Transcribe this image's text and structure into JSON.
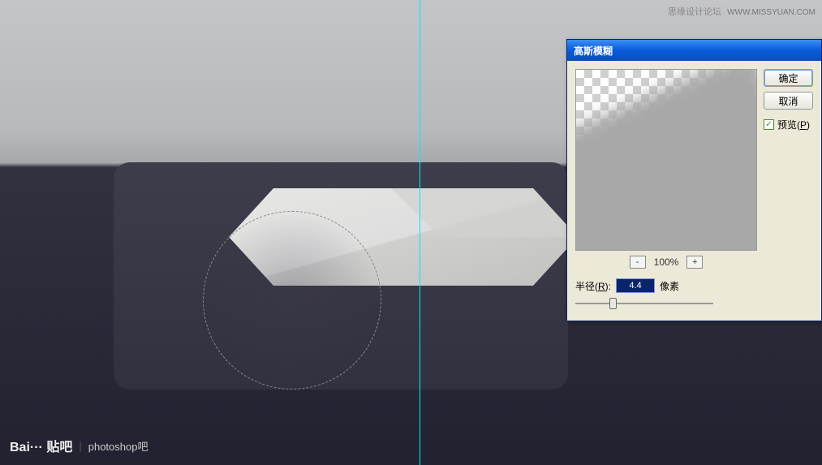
{
  "watermark": {
    "top_right_main": "思缘设计论坛",
    "top_right_sub": "WWW.MISSYUAN.COM",
    "bottom_left_brand": "Bai··· 贴吧",
    "bottom_left_sep": "|",
    "bottom_left_text": "photoshop吧"
  },
  "dialog": {
    "title": "高斯模糊",
    "ok_label": "确定",
    "cancel_label": "取消",
    "preview_label": "预览(P)",
    "preview_underline_char": "P",
    "zoom": {
      "out_label": "-",
      "in_label": "+",
      "percent": "100%"
    },
    "radius": {
      "label_pre": "半径(",
      "label_key": "R",
      "label_post": "):",
      "value": "4.4",
      "unit": "像素"
    }
  }
}
